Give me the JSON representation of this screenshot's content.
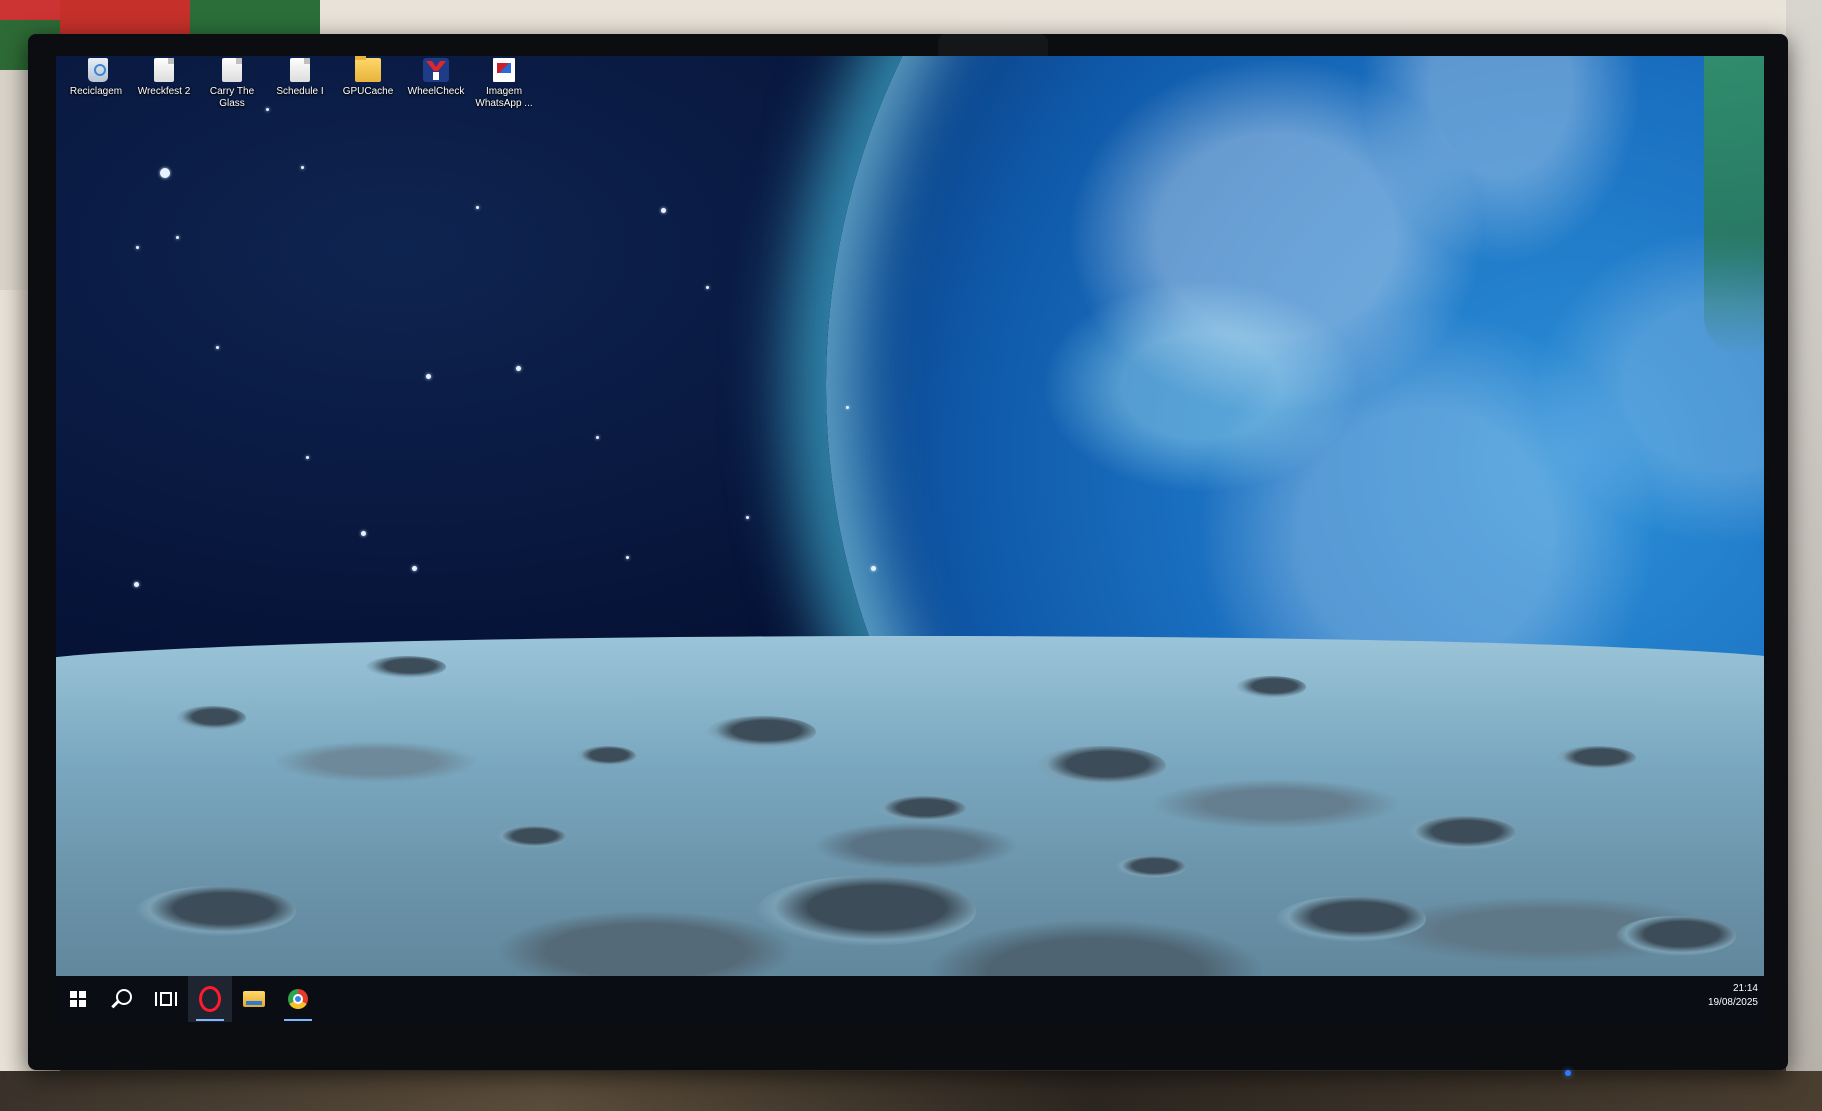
{
  "desktop": {
    "icons": [
      {
        "label": "Reciclagem",
        "icon": "recycle-bin-icon"
      },
      {
        "label": "Wreckfest 2",
        "icon": "file-icon"
      },
      {
        "label": "Carry The\nGlass",
        "icon": "file-icon"
      },
      {
        "label": "Schedule I",
        "icon": "file-icon"
      },
      {
        "label": "GPUCache",
        "icon": "folder-icon"
      },
      {
        "label": "WheelCheck",
        "icon": "wheelcheck-icon"
      },
      {
        "label": "Imagem\nWhatsApp ...",
        "icon": "image-file-icon"
      }
    ]
  },
  "taskbar": {
    "apps": [
      {
        "name": "start",
        "icon": "windows-logo-icon"
      },
      {
        "name": "search",
        "icon": "search-icon"
      },
      {
        "name": "task-view",
        "icon": "task-view-icon"
      },
      {
        "name": "opera",
        "icon": "opera-icon"
      },
      {
        "name": "file-explorer",
        "icon": "folder-icon"
      },
      {
        "name": "chrome",
        "icon": "chrome-icon"
      }
    ],
    "clock": {
      "time": "21:14",
      "date": "19/08/2025"
    }
  },
  "colors": {
    "taskbar": "#0a0d14",
    "opera": "#ff1b2d",
    "active_indicator": "#7fb6ff"
  }
}
